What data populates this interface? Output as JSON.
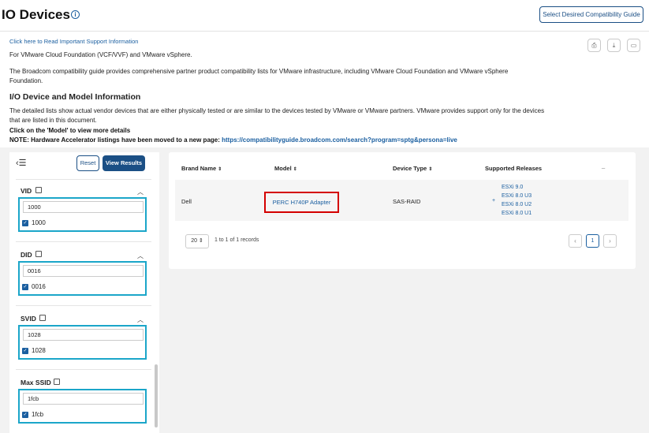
{
  "header": {
    "title": "IO Devices",
    "info_icon": "i",
    "guide_button": "Select Desired Compatibility Guide"
  },
  "intro": {
    "support_link": "Click here to Read Important Support Information",
    "line1": "For VMware Cloud Foundation (VCF/VVF) and VMware vSphere.",
    "line2": "The Broadcom compatibility guide provides comprehensive partner product compatibility lists for VMware infrastructure, including VMware Cloud Foundation and VMware vSphere Foundation.",
    "section_heading": "I/O Device and Model Information",
    "line3": "The detailed lists show actual vendor devices that are either physically tested or are similar to the devices tested by VMware or VMware partners. VMware provides support only for the devices that are listed in this document.",
    "click_note": "Click on the 'Model' to view more details",
    "note_prefix": "NOTE: Hardware Accelerator listings have been moved to a new page: ",
    "note_link": "https://compatibilityguide.broadcom.com/search?program=sptg&persona=live"
  },
  "toolbar": {
    "print_icon": "⎙",
    "download_icon": "⤓",
    "save_icon": "▭"
  },
  "sidebar": {
    "menu_icon": "‹☰",
    "reset_label": "Reset",
    "view_results_label": "View Results",
    "filters": [
      {
        "label": "VID",
        "value": "1000",
        "option": "1000"
      },
      {
        "label": "DID",
        "value": "0016",
        "option": "0016"
      },
      {
        "label": "SVID",
        "value": "1028",
        "option": "1028"
      },
      {
        "label": "Max SSID",
        "value": "1fcb",
        "option": "1fcb"
      }
    ]
  },
  "table": {
    "columns": [
      "Brand Name",
      "Model",
      "Device Type",
      "Supported Releases"
    ],
    "sort_icon": "⇕",
    "collapse_icon": "_",
    "rows": [
      {
        "brand": "Dell",
        "model": "PERC H740P Adapter",
        "device_type": "SAS-RAID",
        "expand_icon": "+",
        "releases": [
          "ESXi 9.0",
          "ESXi 8.0 U3",
          "ESXi 8.0 U2",
          "ESXi 8.0 U1"
        ]
      }
    ]
  },
  "pagination": {
    "page_size": "20 ⇕",
    "records_text": "1 to 1 of 1 records",
    "current_page": "1",
    "prev_icon": "‹",
    "next_icon": "›"
  }
}
